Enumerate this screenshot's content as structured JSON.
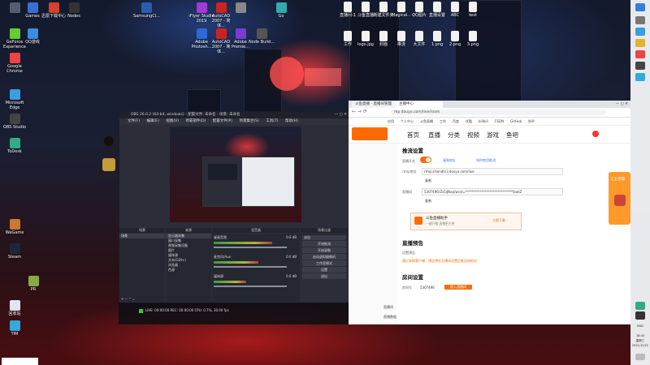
{
  "desktop": {
    "icons": [
      {
        "label": "",
        "color": "#555e70"
      },
      {
        "label": "Games",
        "color": "#3a6fd8"
      },
      {
        "label": "迅雷下载中心",
        "color": "#d8402a"
      },
      {
        "label": "Nodes",
        "color": "#333"
      },
      {
        "label": "SamsungCl...",
        "color": "#2a5db0"
      },
      {
        "label": "iFlyer Studio 2019",
        "color": "#a23bd4"
      },
      {
        "label": "AutoCAD 2007 - 简体...",
        "color": "#c22"
      },
      {
        "label": "",
        "color": "#888"
      },
      {
        "label": "Go",
        "color": "#3aa"
      },
      {
        "label": "GeForce Experience",
        "color": "#6c3"
      },
      {
        "label": "QQ游戏",
        "color": "#3a8de0"
      },
      {
        "label": "Adobe Photosh...",
        "color": "#2a6ad8"
      },
      {
        "label": "AutoCAD 2007 - 简体...",
        "color": "#c22"
      },
      {
        "label": "Adobe Premie...",
        "color": "#7a3bd4"
      },
      {
        "label": "Node Build...",
        "color": "#555"
      },
      {
        "label": "Google Chrome",
        "color": "#e44"
      },
      {
        "label": "Microsoft Edge",
        "color": "#3a9de0"
      },
      {
        "label": "OBS Studio",
        "color": "#444"
      },
      {
        "label": "ToDesk",
        "color": "#3a8"
      },
      {
        "label": "Steam",
        "color": "#1b2838"
      },
      {
        "label": "WeGame",
        "color": "#c73"
      },
      {
        "label": "PR",
        "color": "#8a4"
      },
      {
        "label": "TIM",
        "color": "#3ad"
      },
      {
        "label": "回收站",
        "color": "#e0e6f0"
      }
    ],
    "top_right_files": [
      "直播间-1",
      "斗鱼直播",
      "新建文件夹",
      "Magical...",
      "QQ图片",
      "直播设置",
      "ABC",
      "test",
      "工作",
      "logo.jpg",
      "封面",
      "推流",
      "大文件",
      "1.png",
      "2.png",
      "3.png"
    ]
  },
  "obs": {
    "title": "OBS 26.0.2 (64-bit, windows) - 配置文件: 未命名 - 场景: 未命名",
    "menu": [
      "文件(F)",
      "编辑(E)",
      "视图(V)",
      "停靠部件(D)",
      "配置文件(P)",
      "场景集合(S)",
      "工具(T)",
      "帮助(H)"
    ],
    "docks": {
      "scenes": "场景",
      "sources": "来源",
      "mixer": "混音器",
      "transitions": "场景过渡",
      "controls": "控件"
    },
    "scene_items": [
      "场景"
    ],
    "source_items": [
      "显示器采集",
      "窗口采集",
      "视频采集设备",
      "图片",
      "媒体源",
      "文本(GDI+)",
      "浏览器",
      "色源"
    ],
    "mixer_tracks": [
      {
        "name": "桌面音频",
        "db": "0.0 dB",
        "level": 0.72
      },
      {
        "name": "麦克风/Aux",
        "db": "0.0 dB",
        "level": 0.55
      },
      {
        "name": "媒体源",
        "db": "0.0 dB",
        "level": 0.4
      }
    ],
    "transition": {
      "type": "淡出",
      "duration_label": "时长",
      "duration": "300 ms"
    },
    "controls": [
      "开始推流",
      "开始录制",
      "启动虚拟摄像机",
      "工作室模式",
      "设置",
      "退出"
    ],
    "status": "LIVE: 00:00:00   REC: 00:00:00   CPU: 0.7%, 30.00 fps"
  },
  "browser": {
    "tabs": [
      "斗鱼直播 - 直播间管理",
      "主播中心"
    ],
    "url": "mp.douyu.com/live/room",
    "bookmarks": [
      "应用",
      "个人中心",
      "斗鱼直播",
      "工作",
      "百度",
      "优酷",
      "bilibili",
      "CSDN",
      "GitHub",
      "知乎"
    ],
    "nav": [
      "首页",
      "直播",
      "分类",
      "视频",
      "游戏",
      "鱼吧"
    ],
    "section1": "推流设置",
    "toggle_label": "直播开关",
    "link_a": "复制地址",
    "link_b": "如何使用推流",
    "rtmp_label": "rtmp地址",
    "rtmp_value": "rtmp://sendtc3.douyu.com/live",
    "copy1": "复制",
    "key_label": "直播码",
    "key_value": "5307496rZs5iJNxp/wcst=*****************************faaeZ",
    "copy2": "复制",
    "promo_title": "斗鱼直播助手",
    "promo_sub": "一键开播 直播更方便",
    "promo_btn": "立即下载",
    "section2": "直播预告",
    "preview_lbl": "设置预告",
    "preview_note": "通过本地客户端，预告将在主播间设置后推送给粉丝",
    "section3": "房间设置",
    "room_lbl": "房间号",
    "room_val": "5307496",
    "room_btn": "进入直播间",
    "side_ad": "马上领取",
    "bottom_links": [
      "直播间",
      "直播数据"
    ]
  },
  "taskbar": {
    "time": "18:40",
    "date": "2021/12/22",
    "weekday": "星期三",
    "lang": "ENG"
  }
}
